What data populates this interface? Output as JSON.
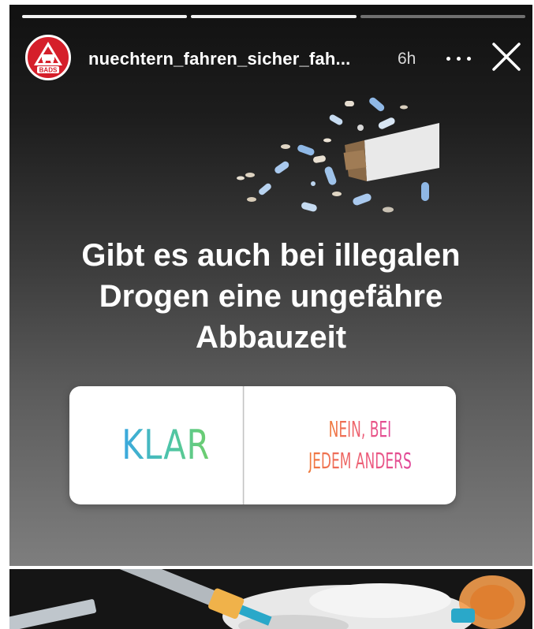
{
  "header": {
    "username": "nuechtern_fahren_sicher_fah...",
    "time": "6h",
    "avatar_label": "BADS",
    "progress": {
      "segments": 3,
      "current_segment": 2,
      "current_progress": 0.0
    }
  },
  "icons": {
    "more": "more-horizontal-icon",
    "close": "close-icon",
    "avatar": "bads-logo-icon"
  },
  "question": {
    "line1": "Gibt es auch bei illegalen",
    "line2": "Drogen eine ungefähre",
    "line3": "Abbauzeit"
  },
  "poll": {
    "option_a": "KLAR",
    "option_b_line1": "NEIN, BEI",
    "option_b_line2": "JEDEM ANDERS"
  },
  "colors": {
    "avatar_red": "#d51f2a",
    "option_a_gradient": [
      "#3aa7e0",
      "#6fce6b"
    ],
    "option_b_gradient": [
      "#f07a3b",
      "#e0479a"
    ]
  }
}
